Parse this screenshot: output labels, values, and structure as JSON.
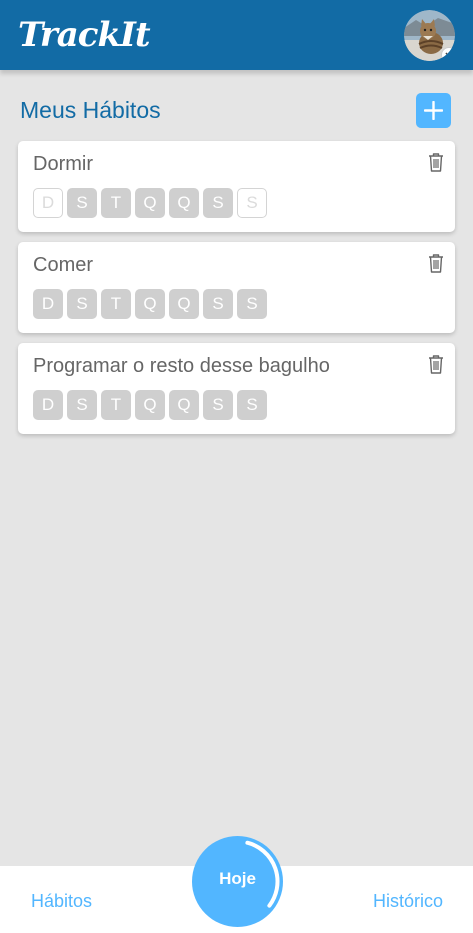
{
  "app": {
    "logo": "TrackIt"
  },
  "header": {
    "title": "Meus Hábitos",
    "add_label": "+"
  },
  "habits": [
    {
      "name": "Dormir",
      "days": [
        {
          "label": "D",
          "selected": false
        },
        {
          "label": "S",
          "selected": true
        },
        {
          "label": "T",
          "selected": true
        },
        {
          "label": "Q",
          "selected": true
        },
        {
          "label": "Q",
          "selected": true
        },
        {
          "label": "S",
          "selected": true
        },
        {
          "label": "S",
          "selected": false
        }
      ]
    },
    {
      "name": "Comer",
      "days": [
        {
          "label": "D",
          "selected": true
        },
        {
          "label": "S",
          "selected": true
        },
        {
          "label": "T",
          "selected": true
        },
        {
          "label": "Q",
          "selected": true
        },
        {
          "label": "Q",
          "selected": true
        },
        {
          "label": "S",
          "selected": true
        },
        {
          "label": "S",
          "selected": true
        }
      ]
    },
    {
      "name": "Programar o resto desse bagulho",
      "days": [
        {
          "label": "D",
          "selected": true
        },
        {
          "label": "S",
          "selected": true
        },
        {
          "label": "T",
          "selected": true
        },
        {
          "label": "Q",
          "selected": true
        },
        {
          "label": "Q",
          "selected": true
        },
        {
          "label": "S",
          "selected": true
        },
        {
          "label": "S",
          "selected": true
        }
      ]
    }
  ],
  "footer": {
    "habits_label": "Hábitos",
    "today_label": "Hoje",
    "history_label": "Histórico",
    "today_progress": 0.33
  },
  "icons": {
    "trash": "trash-icon",
    "avatar_badge": "chevron-down-icon"
  },
  "colors": {
    "primary": "#126BA5",
    "accent": "#52B6FF",
    "day_selected": "#CFCFCF",
    "text": "#666666"
  }
}
